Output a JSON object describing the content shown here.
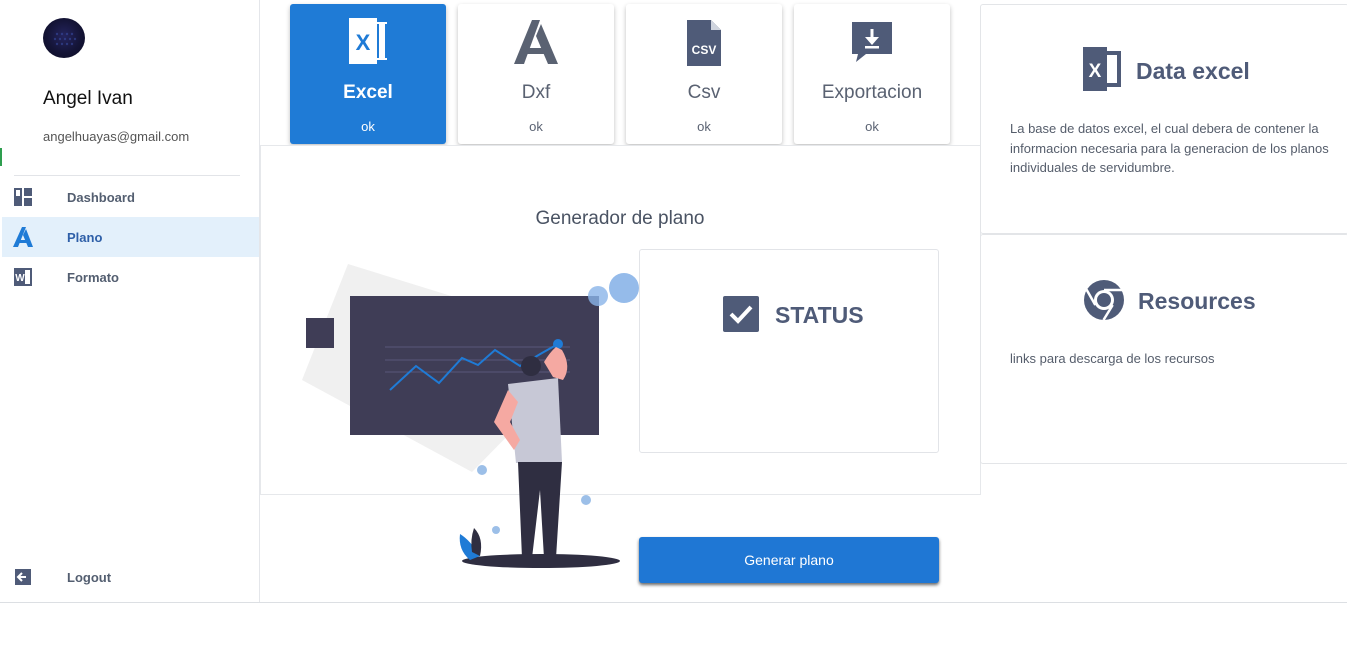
{
  "user": {
    "name": "Angel Ivan",
    "email": "angelhuayas@gmail.com"
  },
  "nav": {
    "items": [
      {
        "label": "Dashboard",
        "icon": "dashboard-icon"
      },
      {
        "label": "Plano",
        "icon": "autocad-icon",
        "active": true
      },
      {
        "label": "Formato",
        "icon": "word-icon"
      }
    ],
    "logout": {
      "label": "Logout",
      "icon": "logout-icon"
    }
  },
  "cards": [
    {
      "title": "Excel",
      "status": "ok",
      "icon": "excel-icon",
      "active": true
    },
    {
      "title": "Dxf",
      "status": "ok",
      "icon": "autocad-icon"
    },
    {
      "title": "Csv",
      "status": "ok",
      "icon": "csv-file-icon"
    },
    {
      "title": "Exportacion",
      "status": "ok",
      "icon": "download-icon"
    }
  ],
  "generator": {
    "title": "Generador de plano",
    "status_label": "STATUS",
    "button_label": "Generar plano"
  },
  "info": {
    "excel": {
      "title": "Data excel",
      "description": "La base de datos excel, el cual debera de contener la informacion necesaria para la generacion de los planos individuales de servidumbre."
    },
    "resources": {
      "title": "Resources",
      "description": "links para descarga de los recursos"
    }
  },
  "colors": {
    "accent": "#1f7bd6",
    "nav_active_bg": "#e3f0fb",
    "icon_slate": "#4f5b78"
  }
}
